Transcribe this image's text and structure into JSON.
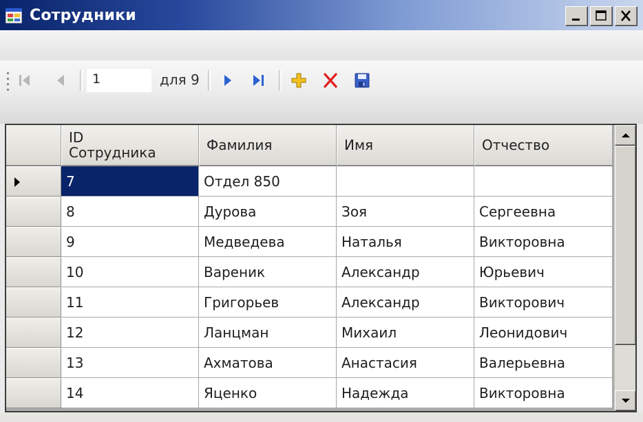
{
  "window": {
    "title": "Сотрудники"
  },
  "navigator": {
    "position": "1",
    "count_label": "для 9"
  },
  "grid": {
    "columns": [
      "ID Сотрудника",
      "Фамилия",
      "Имя",
      "Отчество"
    ],
    "rows": [
      [
        "7",
        "Отдел 850",
        "",
        ""
      ],
      [
        "8",
        "Дурова",
        "Зоя",
        "Сергеевна"
      ],
      [
        "9",
        "Медведева",
        "Наталья",
        "Викторовна"
      ],
      [
        "10",
        "Вареник",
        "Александр",
        "Юрьевич"
      ],
      [
        "11",
        "Григорьев",
        "Александр",
        "Викторович"
      ],
      [
        "12",
        "Ланцман",
        "Михаил",
        "Леонидович"
      ],
      [
        "13",
        "Ахматова",
        "Анастасия",
        "Валерьевна"
      ],
      [
        "14",
        "Яценко",
        "Надежда",
        "Викторовна"
      ]
    ],
    "current_row": 0,
    "selection_color": "#0a246a"
  },
  "colors": {
    "titlebar_start": "#0a246a",
    "titlebar_end": "#c9d6ee",
    "add_icon": "#f0c020",
    "delete_icon": "#e02020",
    "nav_arrow": "#2a62d0"
  },
  "icons": {
    "move_first": "move-first-icon",
    "move_previous": "move-previous-icon",
    "move_next": "move-next-icon",
    "move_last": "move-last-icon",
    "add": "add-new-icon",
    "delete": "delete-icon",
    "save": "save-icon"
  }
}
